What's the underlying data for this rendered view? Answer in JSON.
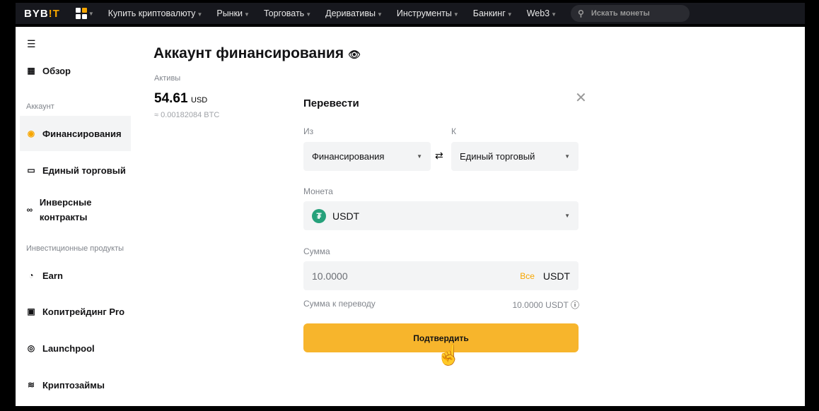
{
  "nav": {
    "logo": "BYB",
    "logo_accent": "!T",
    "items": [
      "Купить криптовалюту",
      "Рынки",
      "Торговать",
      "Деривативы",
      "Инструменты",
      "Банкинг",
      "Web3"
    ],
    "search_placeholder": "Искать монеты"
  },
  "sidebar": {
    "overview": "Обзор",
    "section_account": "Аккаунт",
    "funding": "Финансирования",
    "unified": "Единый торговый",
    "inverse": "Инверсные контракты",
    "section_invest": "Инвестиционные продукты",
    "earn": "Earn",
    "copy": "Копитрейдинг Pro",
    "launchpool": "Launchpool",
    "loans": "Криптозаймы"
  },
  "page": {
    "title": "Аккаунт финансирования",
    "assets_label": "Активы",
    "balance": "54.61",
    "balance_currency": "USD",
    "btc_equiv": "≈ 0.00182084 BTC"
  },
  "transfer": {
    "title": "Перевести",
    "from_label": "Из",
    "to_label": "К",
    "from": "Финансирования",
    "to": "Единый торговый",
    "coin_label": "Монета",
    "coin": "USDT",
    "amount_label": "Сумма",
    "amount": "10.0000",
    "all": "Все",
    "amount_currency": "USDT",
    "transfer_amount_label": "Сумма к переводу",
    "transfer_amount": "10.0000 USDT",
    "confirm": "Подтвердить"
  },
  "colors": {
    "accent": "#f7b52c",
    "brand": "#f7a600",
    "tether": "#26a17b"
  }
}
